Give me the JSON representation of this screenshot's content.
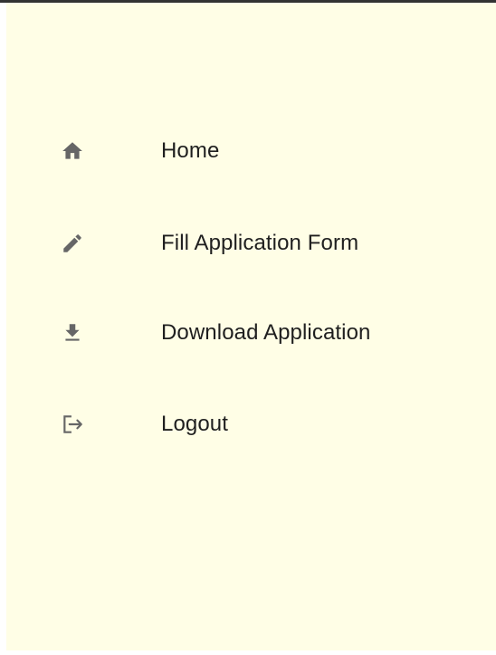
{
  "sidebar": {
    "items": [
      {
        "label": "Home",
        "icon": "home-icon"
      },
      {
        "label": "Fill Application Form",
        "icon": "pencil-icon"
      },
      {
        "label": "Download Application",
        "icon": "download-icon"
      },
      {
        "label": "Logout",
        "icon": "logout-icon"
      }
    ]
  },
  "colors": {
    "drawer_background": "#fffee6",
    "icon": "#666666",
    "text": "#1f1f1f"
  }
}
